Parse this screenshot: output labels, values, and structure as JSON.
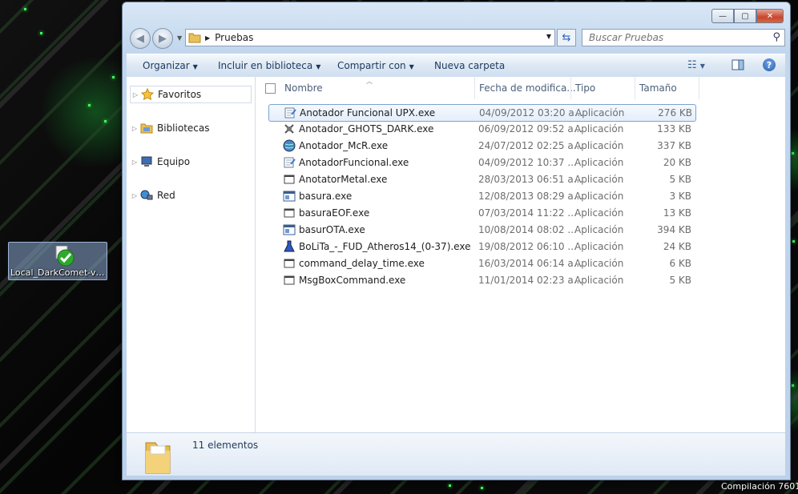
{
  "desktop": {
    "icon_label": "Local_DarkComet-v5...",
    "build_text": "Compilación 7601"
  },
  "window": {
    "controls": {
      "minimize": "—",
      "maximize": "▢",
      "close": "✕"
    },
    "address": {
      "path": "Pruebas"
    },
    "search": {
      "placeholder": "Buscar Pruebas"
    }
  },
  "toolbar": {
    "organize": "Organizar",
    "include_library": "Incluir en biblioteca",
    "share_with": "Compartir con",
    "new_folder": "Nueva carpeta"
  },
  "nav": {
    "items": [
      {
        "label": "Favoritos",
        "icon": "star-icon"
      },
      {
        "label": "Bibliotecas",
        "icon": "libraries-icon"
      },
      {
        "label": "Equipo",
        "icon": "computer-icon"
      },
      {
        "label": "Red",
        "icon": "network-icon"
      }
    ]
  },
  "columns": {
    "name": "Nombre",
    "date": "Fecha de modifica...",
    "type": "Tipo",
    "size": "Tamaño"
  },
  "files": [
    {
      "name": "Anotador Funcional UPX.exe",
      "date": "04/09/2012 03:20 a...",
      "type": "Aplicación",
      "size": "276 KB",
      "icon": "notepad-icon"
    },
    {
      "name": "Anotador_GHOTS_DARK.exe",
      "date": "06/09/2012 09:52 a...",
      "type": "Aplicación",
      "size": "133 KB",
      "icon": "ghost-icon"
    },
    {
      "name": "Anotador_McR.exe",
      "date": "24/07/2012 02:25 a...",
      "type": "Aplicación",
      "size": "337 KB",
      "icon": "globe-icon"
    },
    {
      "name": "AnotadorFuncional.exe",
      "date": "04/09/2012 10:37 ...",
      "type": "Aplicación",
      "size": "20 KB",
      "icon": "notepad-icon"
    },
    {
      "name": "AnotatorMetal.exe",
      "date": "28/03/2013 06:51 a...",
      "type": "Aplicación",
      "size": "5 KB",
      "icon": "app-window-icon"
    },
    {
      "name": "basura.exe",
      "date": "12/08/2013 08:29 a...",
      "type": "Aplicación",
      "size": "3 KB",
      "icon": "exe-icon"
    },
    {
      "name": "basuraEOF.exe",
      "date": "07/03/2014 11:22 ...",
      "type": "Aplicación",
      "size": "13 KB",
      "icon": "app-window-icon"
    },
    {
      "name": "basurOTA.exe",
      "date": "10/08/2014 08:02 ...",
      "type": "Aplicación",
      "size": "394 KB",
      "icon": "exe-icon"
    },
    {
      "name": "BoLiTa_-_FUD_Atheros14_(0-37).exe",
      "date": "19/08/2012 06:10 ...",
      "type": "Aplicación",
      "size": "24 KB",
      "icon": "flask-icon"
    },
    {
      "name": "command_delay_time.exe",
      "date": "16/03/2014 06:14 a...",
      "type": "Aplicación",
      "size": "6 KB",
      "icon": "app-window-icon"
    },
    {
      "name": "MsgBoxCommand.exe",
      "date": "11/01/2014 02:23 a...",
      "type": "Aplicación",
      "size": "5 KB",
      "icon": "app-window-icon"
    }
  ],
  "status": {
    "count": "11 elementos"
  }
}
